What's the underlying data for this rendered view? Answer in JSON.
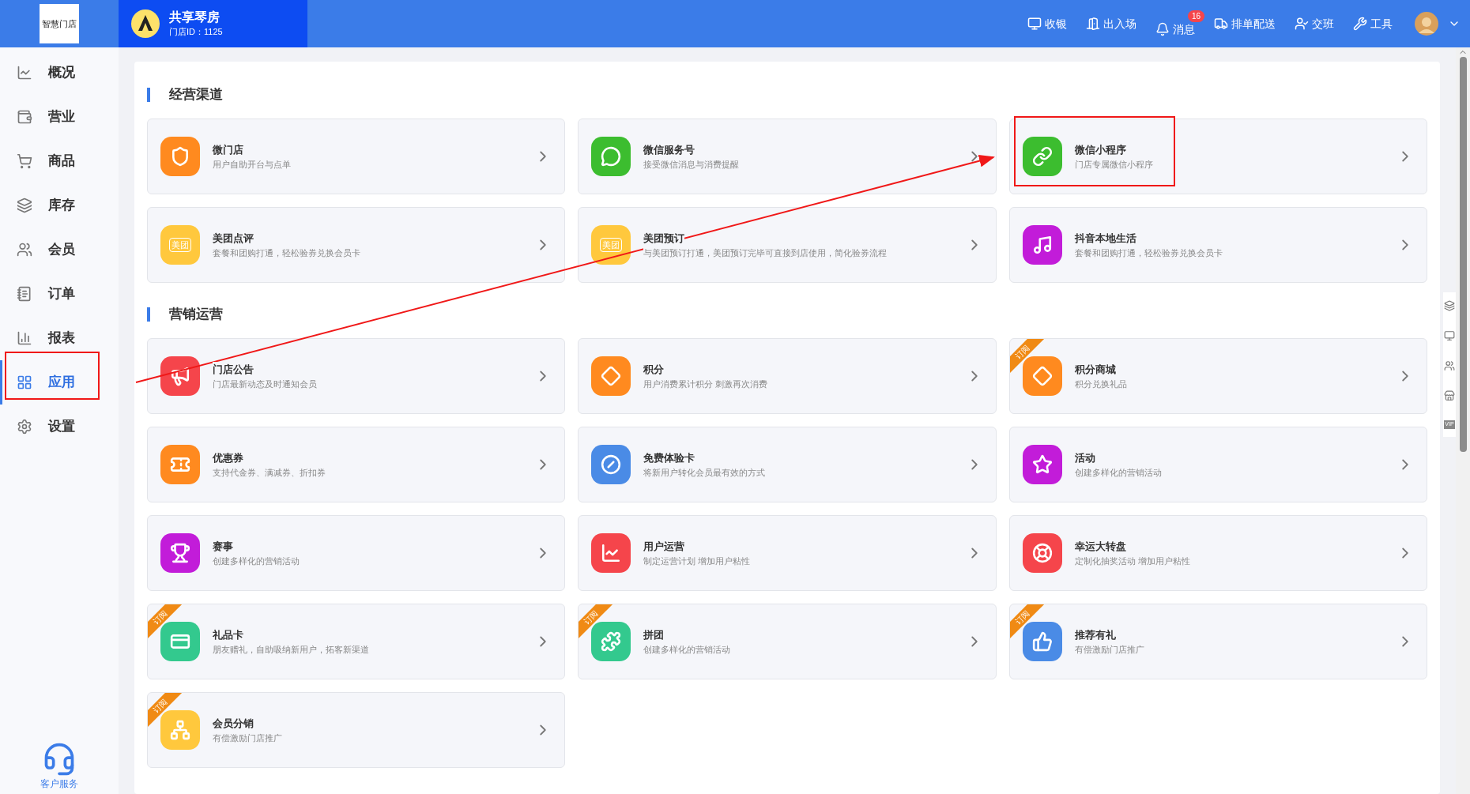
{
  "header": {
    "logo_text": "智慧门店",
    "store_name": "共享琴房",
    "store_id": "门店ID：1125",
    "actions": [
      {
        "label": "收银"
      },
      {
        "label": "出入场"
      },
      {
        "label": "消息",
        "badge": "16"
      },
      {
        "label": "排单配送"
      },
      {
        "label": "交班"
      },
      {
        "label": "工具"
      }
    ]
  },
  "sidebar": {
    "items": [
      {
        "label": "概况",
        "selected": false
      },
      {
        "label": "营业",
        "selected": false
      },
      {
        "label": "商品",
        "selected": false
      },
      {
        "label": "库存",
        "selected": false
      },
      {
        "label": "会员",
        "selected": false
      },
      {
        "label": "订单",
        "selected": false
      },
      {
        "label": "报表",
        "selected": false
      },
      {
        "label": "应用",
        "selected": true
      },
      {
        "label": "设置",
        "selected": false
      }
    ],
    "support": "客户服务"
  },
  "sections": [
    {
      "title": "经营渠道",
      "cards": [
        {
          "title": "微门店",
          "subtitle": "用户自助开台与点单",
          "color": "#ff8a1f"
        },
        {
          "title": "微信服务号",
          "subtitle": "接受微信消息与消费提醒",
          "color": "#3cbd2f"
        },
        {
          "title": "微信小程序",
          "subtitle": "门店专属微信小程序",
          "color": "#3cbd2f"
        },
        {
          "title": "美团点评",
          "subtitle": "套餐和团购打通，轻松验券兑换会员卡",
          "color": "#ffc83d",
          "icon_text": "美团"
        },
        {
          "title": "美团预订",
          "subtitle": "与美团预订打通，美团预订完毕可直接到店使用，简化验券流程",
          "color": "#ffc83d",
          "icon_text": "美团"
        },
        {
          "title": "抖音本地生活",
          "subtitle": "套餐和团购打通，轻松验券兑换会员卡",
          "color": "#c21cd9"
        }
      ]
    },
    {
      "title": "营销运营",
      "cards": [
        {
          "title": "门店公告",
          "subtitle": "门店最新动态及时通知会员",
          "color": "#f5454b"
        },
        {
          "title": "积分",
          "subtitle": "用户消费累计积分 刺激再次消费",
          "color": "#ff8a1f"
        },
        {
          "title": "积分商城",
          "subtitle": "积分兑换礼品",
          "color": "#ff8a1f",
          "ribbon": "订阅"
        },
        {
          "title": "优惠券",
          "subtitle": "支持代金券、满减券、折扣券",
          "color": "#ff8a1f"
        },
        {
          "title": "免费体验卡",
          "subtitle": "将新用户转化会员最有效的方式",
          "color": "#4a8be6"
        },
        {
          "title": "活动",
          "subtitle": "创建多样化的营销活动",
          "color": "#c21cd9"
        },
        {
          "title": "赛事",
          "subtitle": "创建多样化的营销活动",
          "color": "#c21cd9"
        },
        {
          "title": "用户运营",
          "subtitle": "制定运营计划 增加用户粘性",
          "color": "#f5454b"
        },
        {
          "title": "幸运大转盘",
          "subtitle": "定制化抽奖活动 增加用户粘性",
          "color": "#f5454b"
        },
        {
          "title": "礼品卡",
          "subtitle": "朋友赠礼，自助吸纳新用户，拓客新渠道",
          "color": "#33c98e",
          "ribbon": "订阅"
        },
        {
          "title": "拼团",
          "subtitle": "创建多样化的营销活动",
          "color": "#33c98e",
          "ribbon": "订阅"
        },
        {
          "title": "推荐有礼",
          "subtitle": "有偿激励门店推广",
          "color": "#4a8be6",
          "ribbon": "订阅"
        },
        {
          "title": "会员分销",
          "subtitle": "有偿激励门店推广",
          "color": "#ffc83d",
          "ribbon": "订阅"
        }
      ]
    }
  ],
  "floating_tools": {
    "vip_label": "VIP"
  }
}
